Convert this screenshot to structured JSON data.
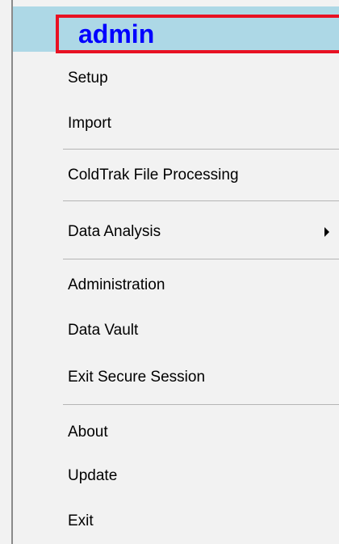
{
  "header": {
    "user": "admin"
  },
  "menu": {
    "items": [
      {
        "label": "Setup"
      },
      {
        "label": "Import"
      },
      {
        "label": "ColdTrak File Processing"
      },
      {
        "label": "Data Analysis",
        "has_submenu": true
      },
      {
        "label": "Administration"
      },
      {
        "label": "Data Vault"
      },
      {
        "label": "Exit Secure Session"
      },
      {
        "label": "About"
      },
      {
        "label": "Update"
      },
      {
        "label": "Exit"
      }
    ]
  },
  "colors": {
    "header_background": "#add8e6",
    "header_text": "#0000ff",
    "highlight_outline": "#e81123",
    "menu_background": "#f2f2f2"
  }
}
